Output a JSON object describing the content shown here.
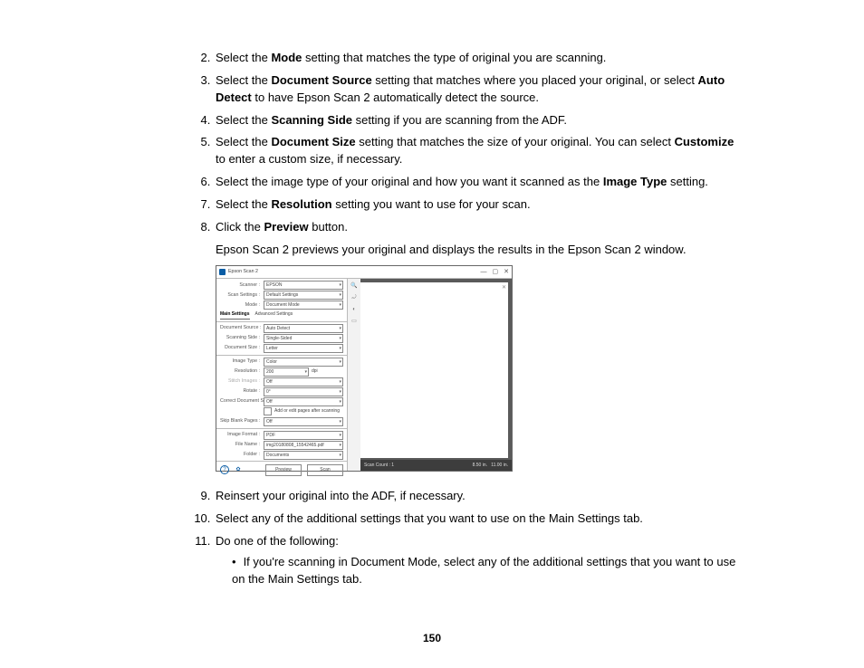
{
  "steps": {
    "s2": {
      "pre": "Select the ",
      "b": "Mode",
      "post": " setting that matches the type of original you are scanning."
    },
    "s3": {
      "pre": "Select the ",
      "b1": "Document Source",
      "mid": " setting that matches where you placed your original, or select ",
      "b2": "Auto Detect",
      "post": " to have Epson Scan 2 automatically detect the source."
    },
    "s4": {
      "pre": "Select the ",
      "b": "Scanning Side",
      "post": " setting if you are scanning from the ADF."
    },
    "s5": {
      "pre": "Select the ",
      "b1": "Document Size",
      "mid": " setting that matches the size of your original. You can select ",
      "b2": "Customize",
      "post": " to enter a custom size, if necessary."
    },
    "s6": {
      "pre": "Select the image type of your original and how you want it scanned as the ",
      "b": "Image Type",
      "post": " setting."
    },
    "s7": {
      "pre": "Select the ",
      "b": "Resolution",
      "post": " setting you want to use for your scan."
    },
    "s8": {
      "pre": "Click the ",
      "b": "Preview",
      "post": " button.",
      "p2": "Epson Scan 2 previews your original and displays the results in the Epson Scan 2 window."
    },
    "s9": "Reinsert your original into the ADF, if necessary.",
    "s10": "Select any of the additional settings that you want to use on the Main Settings tab.",
    "s11": {
      "lead": "Do one of the following:",
      "bullet": "If you're scanning in Document Mode, select any of the additional settings that you want to use on the Main Settings tab."
    }
  },
  "shot": {
    "title": "Epson Scan 2",
    "win_min": "—",
    "win_max": "▢",
    "win_close": "✕",
    "scanner_lbl": "Scanner :",
    "scanner_val": "EPSON",
    "scan_settings_lbl": "Scan Settings :",
    "scan_settings_val": "Default Settings",
    "mode_lbl": "Mode :",
    "mode_val": "Document Mode",
    "tab_main": "Main Settings",
    "tab_adv": "Advanced Settings",
    "doc_source_lbl": "Document Source :",
    "doc_source_val": "Auto Detect",
    "scan_side_lbl": "Scanning Side :",
    "scan_side_val": "Single-Sided",
    "doc_size_lbl": "Document Size :",
    "doc_size_val": "Letter",
    "img_type_lbl": "Image Type :",
    "img_type_val": "Color",
    "res_lbl": "Resolution :",
    "res_val": "200",
    "dpi": "dpi",
    "stitch_lbl": "Stitch Images :",
    "stitch_val": "Off",
    "rotate_lbl": "Rotate :",
    "rotate_val": "0°",
    "skew_lbl": "Correct Document Skew :",
    "skew_val": "Off",
    "addedit": "Add or edit pages after scanning",
    "skip_lbl": "Skip Blank Pages :",
    "skip_val": "Off",
    "img_fmt_lbl": "Image Format :",
    "img_fmt_val": "PDF",
    "file_lbl": "File Name :",
    "file_val": "img20180808_15542465.pdf",
    "folder_lbl": "Folder :",
    "folder_val": "Documents",
    "preview_btn": "Preview",
    "scan_btn": "Scan",
    "status_left": "Scan Count : 1",
    "status_r1": "8.50 in.",
    "status_r2": "11.00 in."
  },
  "page_number": "150"
}
